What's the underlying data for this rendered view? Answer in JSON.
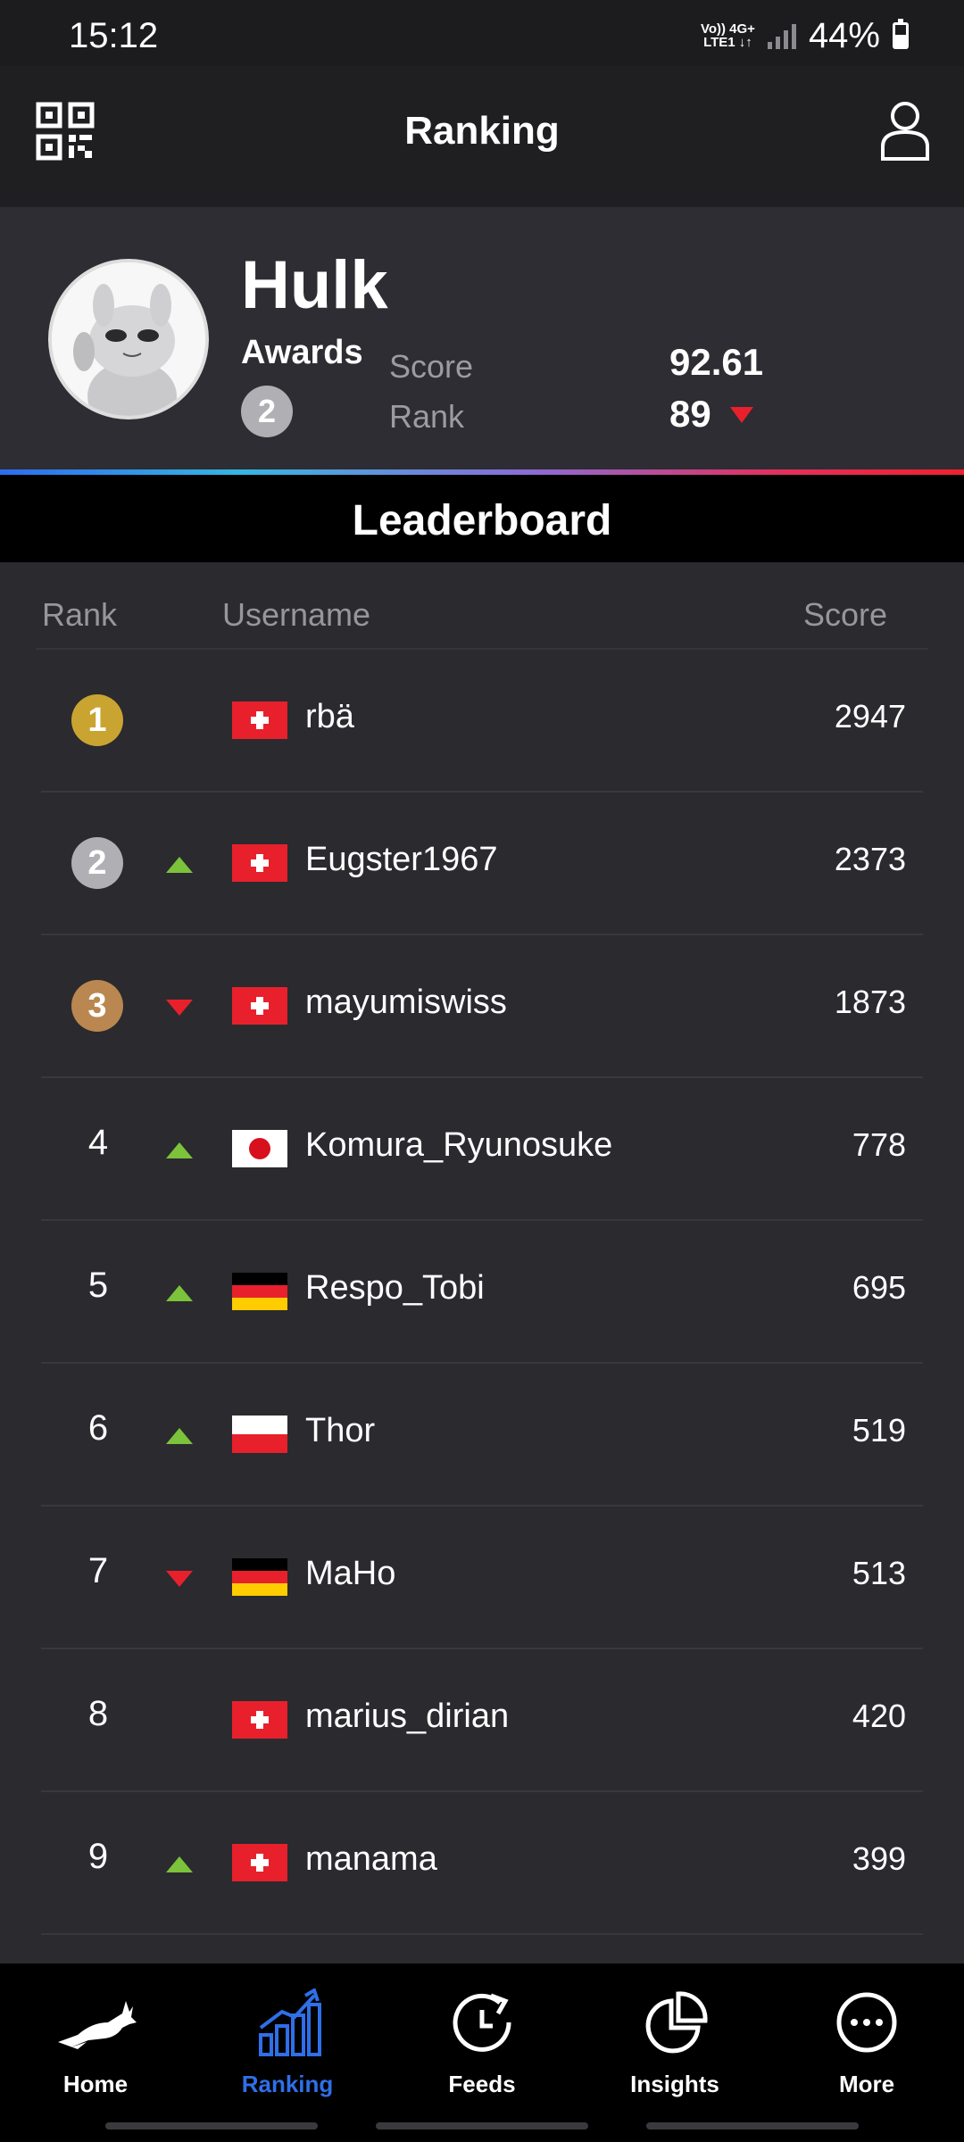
{
  "status_bar": {
    "time": "15:12",
    "net_top": "Vo)) 4G+",
    "net_bottom": "LTE1 ↓↑",
    "battery": "44%"
  },
  "header": {
    "title": "Ranking"
  },
  "user": {
    "name": "Hulk",
    "awards_label": "Awards",
    "awards_count": "2",
    "score_label": "Score",
    "score_value": "92.61",
    "rank_label": "Rank",
    "rank_value": "89",
    "rank_trend": "down"
  },
  "leaderboard": {
    "title": "Leaderboard",
    "columns": {
      "rank": "Rank",
      "username": "Username",
      "score": "Score"
    },
    "rows": [
      {
        "rank": "1",
        "medal": "gold",
        "trend": "none",
        "flag": "switzerland",
        "username": "rbä",
        "score": "2947"
      },
      {
        "rank": "2",
        "medal": "silver",
        "trend": "up",
        "flag": "switzerland",
        "username": "Eugster1967",
        "score": "2373"
      },
      {
        "rank": "3",
        "medal": "bronze",
        "trend": "down",
        "flag": "switzerland",
        "username": "mayumiswiss",
        "score": "1873"
      },
      {
        "rank": "4",
        "medal": "none",
        "trend": "up",
        "flag": "japan",
        "username": "Komura_Ryunosuke",
        "score": "778"
      },
      {
        "rank": "5",
        "medal": "none",
        "trend": "up",
        "flag": "germany",
        "username": "Respo_Tobi",
        "score": "695"
      },
      {
        "rank": "6",
        "medal": "none",
        "trend": "up",
        "flag": "poland",
        "username": "Thor",
        "score": "519"
      },
      {
        "rank": "7",
        "medal": "none",
        "trend": "down",
        "flag": "germany",
        "username": "MaHo",
        "score": "513"
      },
      {
        "rank": "8",
        "medal": "none",
        "trend": "none",
        "flag": "switzerland",
        "username": "marius_dirian",
        "score": "420"
      },
      {
        "rank": "9",
        "medal": "none",
        "trend": "up",
        "flag": "switzerland",
        "username": "manama",
        "score": "399"
      }
    ]
  },
  "nav": [
    {
      "label": "Home",
      "icon": "gazelle-icon",
      "active": false
    },
    {
      "label": "Ranking",
      "icon": "ranking-chart-icon",
      "active": true
    },
    {
      "label": "Feeds",
      "icon": "feeds-clock-icon",
      "active": false
    },
    {
      "label": "Insights",
      "icon": "insights-pie-icon",
      "active": false
    },
    {
      "label": "More",
      "icon": "more-dots-icon",
      "active": false
    }
  ],
  "colors": {
    "accent": "#2f6fe8",
    "trend_up": "#7cc23a",
    "trend_down": "#e8202c",
    "gold": "#c9a431",
    "silver": "#b0b0b4",
    "bronze": "#b9874f"
  }
}
